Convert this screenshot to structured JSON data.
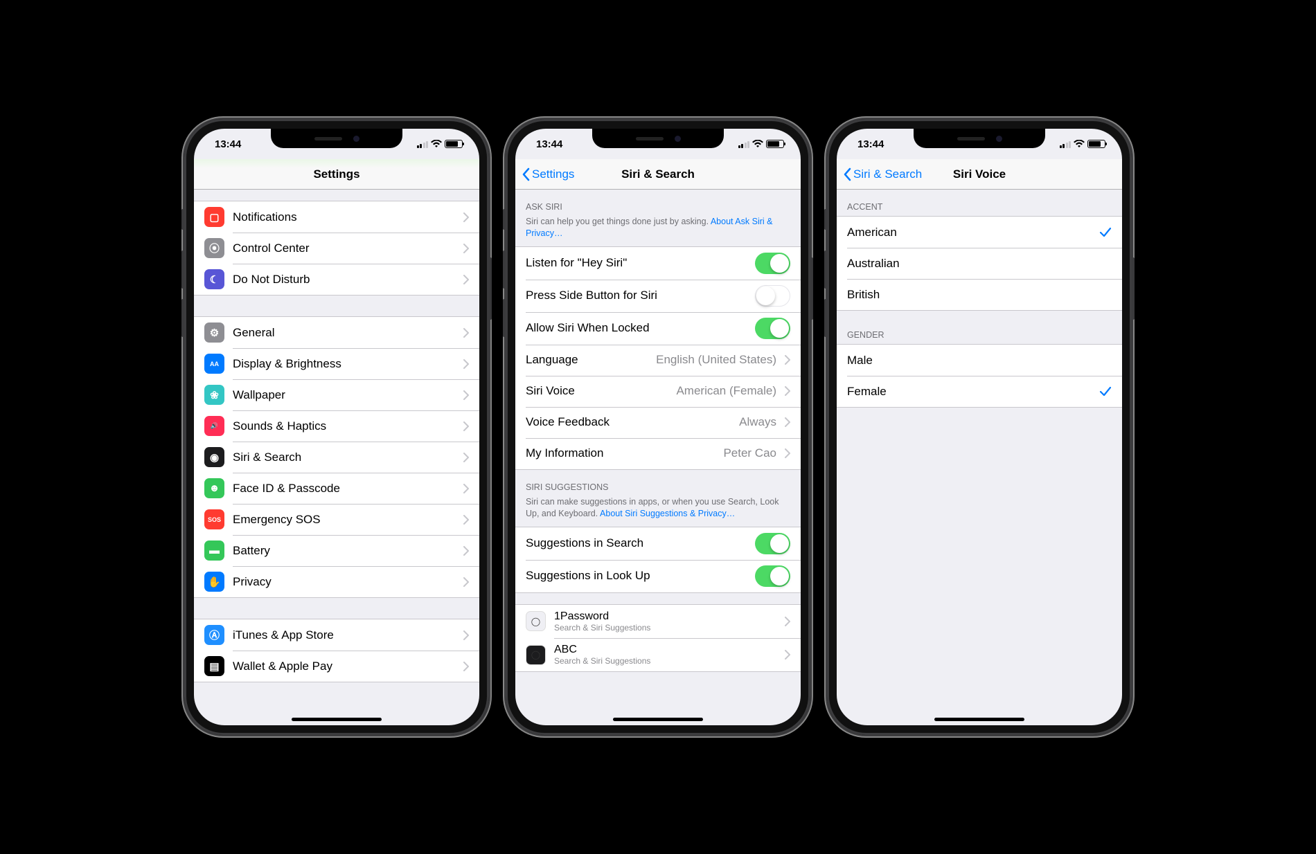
{
  "statusbar": {
    "time": "13:44"
  },
  "screen1": {
    "title": "Settings",
    "group1": [
      {
        "label": "Notifications",
        "icon": "notifications",
        "iconColor": "#ff3b30"
      },
      {
        "label": "Control Center",
        "icon": "controlcenter",
        "iconColor": "#8e8e93"
      },
      {
        "label": "Do Not Disturb",
        "icon": "dnd",
        "iconColor": "#5856d6"
      }
    ],
    "group2": [
      {
        "label": "General",
        "icon": "general",
        "iconColor": "#8e8e93"
      },
      {
        "label": "Display & Brightness",
        "icon": "display",
        "iconColor": "#007aff"
      },
      {
        "label": "Wallpaper",
        "icon": "wallpaper",
        "iconColor": "#33c6c4"
      },
      {
        "label": "Sounds & Haptics",
        "icon": "sounds",
        "iconColor": "#ff2d55"
      },
      {
        "label": "Siri & Search",
        "icon": "siri",
        "iconColor": "#1c1c1e"
      },
      {
        "label": "Face ID & Passcode",
        "icon": "faceid",
        "iconColor": "#34c759"
      },
      {
        "label": "Emergency SOS",
        "icon": "sos",
        "iconColor": "#ff3b30"
      },
      {
        "label": "Battery",
        "icon": "battery",
        "iconColor": "#34c759"
      },
      {
        "label": "Privacy",
        "icon": "privacy",
        "iconColor": "#007aff"
      }
    ],
    "group3": [
      {
        "label": "iTunes & App Store",
        "icon": "appstore",
        "iconColor": "#1f8fff"
      },
      {
        "label": "Wallet & Apple Pay",
        "icon": "wallet",
        "iconColor": "#000000"
      }
    ]
  },
  "screen2": {
    "back": "Settings",
    "title": "Siri & Search",
    "askHeader": "ASK SIRI",
    "askFooter": "Siri can help you get things done just by asking. ",
    "askFooterLink": "About Ask Siri & Privacy…",
    "toggles": [
      {
        "label": "Listen for \"Hey Siri\"",
        "on": true
      },
      {
        "label": "Press Side Button for Siri",
        "on": false
      },
      {
        "label": "Allow Siri When Locked",
        "on": true
      }
    ],
    "links": [
      {
        "label": "Language",
        "value": "English (United States)"
      },
      {
        "label": "Siri Voice",
        "value": "American (Female)"
      },
      {
        "label": "Voice Feedback",
        "value": "Always"
      },
      {
        "label": "My Information",
        "value": "Peter Cao"
      }
    ],
    "suggHeader": "SIRI SUGGESTIONS",
    "suggFooter": "Siri can make suggestions in apps, or when you use Search, Look Up, and Keyboard. ",
    "suggFooterLink": "About Siri Suggestions & Privacy…",
    "suggToggles": [
      {
        "label": "Suggestions in Search",
        "on": true
      },
      {
        "label": "Suggestions in Look Up",
        "on": true
      }
    ],
    "apps": [
      {
        "label": "1Password",
        "sub": "Search & Siri Suggestions",
        "iconColor": "#efeff4"
      },
      {
        "label": "ABC",
        "sub": "Search & Siri Suggestions",
        "iconColor": "#1c1c1e"
      }
    ]
  },
  "screen3": {
    "back": "Siri & Search",
    "title": "Siri Voice",
    "accentHeader": "ACCENT",
    "accents": [
      {
        "label": "American",
        "selected": true
      },
      {
        "label": "Australian",
        "selected": false
      },
      {
        "label": "British",
        "selected": false
      }
    ],
    "genderHeader": "GENDER",
    "genders": [
      {
        "label": "Male",
        "selected": false
      },
      {
        "label": "Female",
        "selected": true
      }
    ]
  },
  "icons": {
    "notifications": "▢",
    "controlcenter": "⦿",
    "dnd": "☾",
    "general": "⚙",
    "display": "AA",
    "wallpaper": "❀",
    "sounds": "🔊",
    "siri": "◉",
    "faceid": "☻",
    "sos": "SOS",
    "battery": "▬",
    "privacy": "✋",
    "appstore": "Ⓐ",
    "wallet": "▤"
  }
}
